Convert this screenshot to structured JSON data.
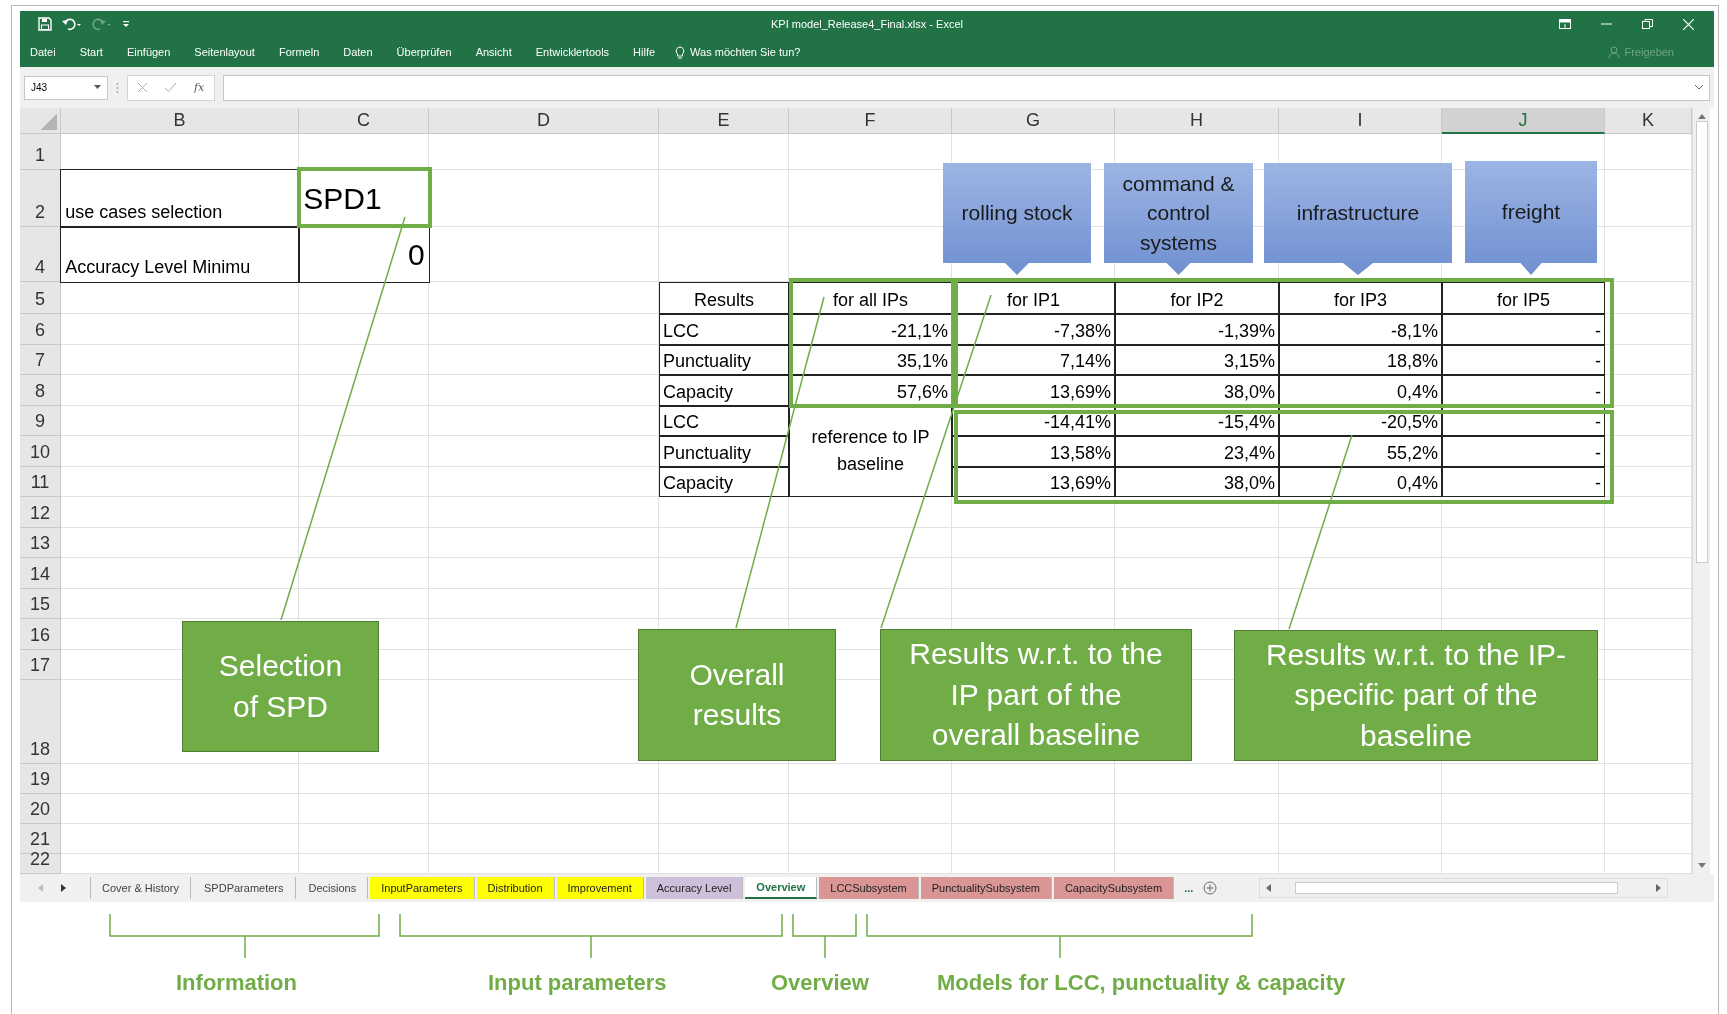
{
  "window": {
    "title": "KPI model_Release4_Final.xlsx  -  Excel",
    "share": "Freigeben"
  },
  "ribbon_tabs": [
    "Datei",
    "Start",
    "Einfügen",
    "Seitenlayout",
    "Formeln",
    "Daten",
    "Überprüfen",
    "Ansicht",
    "Entwicklertools",
    "Hilfe"
  ],
  "tell_me": "Was möchten Sie tun?",
  "formula_bar": {
    "name_box": "J43",
    "function_label": "fx"
  },
  "sheet": {
    "columns": [
      {
        "label": "B",
        "selected": false
      },
      {
        "label": "C",
        "selected": false
      },
      {
        "label": "D",
        "selected": false
      },
      {
        "label": "E",
        "selected": false
      },
      {
        "label": "F",
        "selected": false
      },
      {
        "label": "G",
        "selected": false
      },
      {
        "label": "H",
        "selected": false
      },
      {
        "label": "I",
        "selected": false
      },
      {
        "label": "J",
        "selected": true
      },
      {
        "label": "K",
        "selected": false
      }
    ],
    "rows": [
      "1",
      "2",
      "4",
      "5",
      "6",
      "7",
      "8",
      "9",
      "10",
      "11",
      "12",
      "13",
      "14",
      "15",
      "16",
      "17",
      "18",
      "19",
      "20",
      "21",
      "22"
    ],
    "selection": {
      "label": "use cases selection",
      "value": "SPD1"
    },
    "accuracy": {
      "label": "Accuracy Level Minimu",
      "value": "0"
    },
    "results": {
      "header": [
        "Results",
        "for all IPs",
        "for IP1",
        "for IP2",
        "for IP3",
        "for IP5"
      ],
      "overall": [
        {
          "label": "LCC",
          "values": [
            "-21,1%",
            "-7,38%",
            "-1,39%",
            "-8,1%",
            "-"
          ]
        },
        {
          "label": "Punctuality",
          "values": [
            "35,1%",
            "7,14%",
            "3,15%",
            "18,8%",
            "-"
          ]
        },
        {
          "label": "Capacity",
          "values": [
            "57,6%",
            "13,69%",
            "38,0%",
            "0,4%",
            "-"
          ]
        }
      ],
      "reference": "reference to IP baseline",
      "specific": [
        {
          "label": "LCC",
          "values": [
            "-14,41%",
            "-15,4%",
            "-20,5%",
            "-"
          ]
        },
        {
          "label": "Punctuality",
          "values": [
            "13,58%",
            "23,4%",
            "55,2%",
            "-"
          ]
        },
        {
          "label": "Capacity",
          "values": [
            "13,69%",
            "38,0%",
            "0,4%",
            "-"
          ]
        }
      ]
    }
  },
  "callouts": [
    "rolling stock",
    "command & control systems",
    "infrastructure",
    "freight"
  ],
  "annotations": [
    "Selection of SPD",
    "Overall results",
    "Results w.r.t. to the IP part of the overall baseline",
    "Results w.r.t. to the IP-specific part of the baseline"
  ],
  "sheet_tabs": [
    {
      "name": "Cover & History",
      "selected": false
    },
    {
      "name": "SPDParameters",
      "selected": false
    },
    {
      "name": "Decisions",
      "selected": false
    },
    {
      "name": "InputParameters",
      "selected": false,
      "color": "#ffff00"
    },
    {
      "name": "Distribution",
      "selected": false,
      "color": "#ffff00"
    },
    {
      "name": "Improvement",
      "selected": false,
      "color": "#ffff00"
    },
    {
      "name": "Accuracy Level",
      "selected": false,
      "color": "#ccc0da"
    },
    {
      "name": "Overview",
      "selected": true
    },
    {
      "name": "LCCSubsystem",
      "selected": false,
      "color": "#da9694"
    },
    {
      "name": "PunctualitySubsystem",
      "selected": false,
      "color": "#da9694"
    },
    {
      "name": "CapacitySubsystem",
      "selected": false,
      "color": "#da9694"
    }
  ],
  "more_tabs": "...",
  "groups": [
    "Information",
    "Input parameters",
    "Overview",
    "Models for LCC, punctuality & capacity"
  ]
}
